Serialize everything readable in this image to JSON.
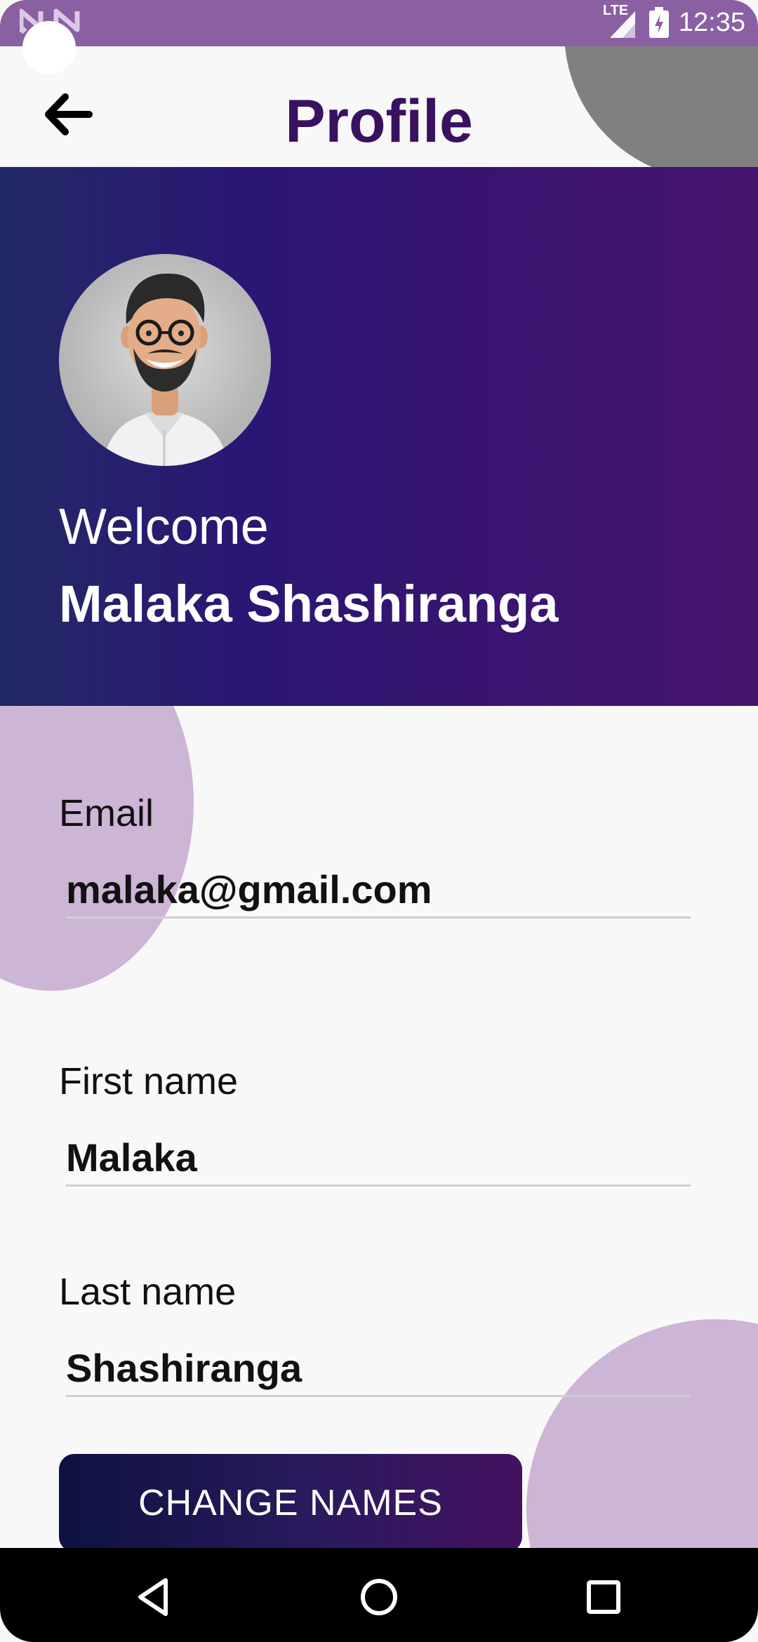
{
  "status_bar": {
    "time": "12:35",
    "network_label": "LTE",
    "icons": [
      "notification-n-icon",
      "notification-n-icon",
      "signal-icon",
      "battery-charging-icon"
    ]
  },
  "app_bar": {
    "title": "Profile",
    "back_icon": "arrow-back-icon"
  },
  "profile": {
    "greeting": "Welcome",
    "full_name": "Malaka Shashiranga"
  },
  "form": {
    "email_label": "Email",
    "email_value": "malaka@gmail.com",
    "first_name_label": "First name",
    "first_name_value": "Malaka",
    "last_name_label": "Last name",
    "last_name_value": "Shashiranga",
    "submit_label": "CHANGE NAMES"
  },
  "nav_bar": {
    "icons": [
      "back-triangle-icon",
      "home-circle-icon",
      "recents-square-icon"
    ]
  },
  "colors": {
    "title": "#3a1160",
    "status_bar": "#8a60a3",
    "accent_circle": "#cdb5d6",
    "banner_start": "#222a66",
    "banner_end": "#45146c"
  }
}
